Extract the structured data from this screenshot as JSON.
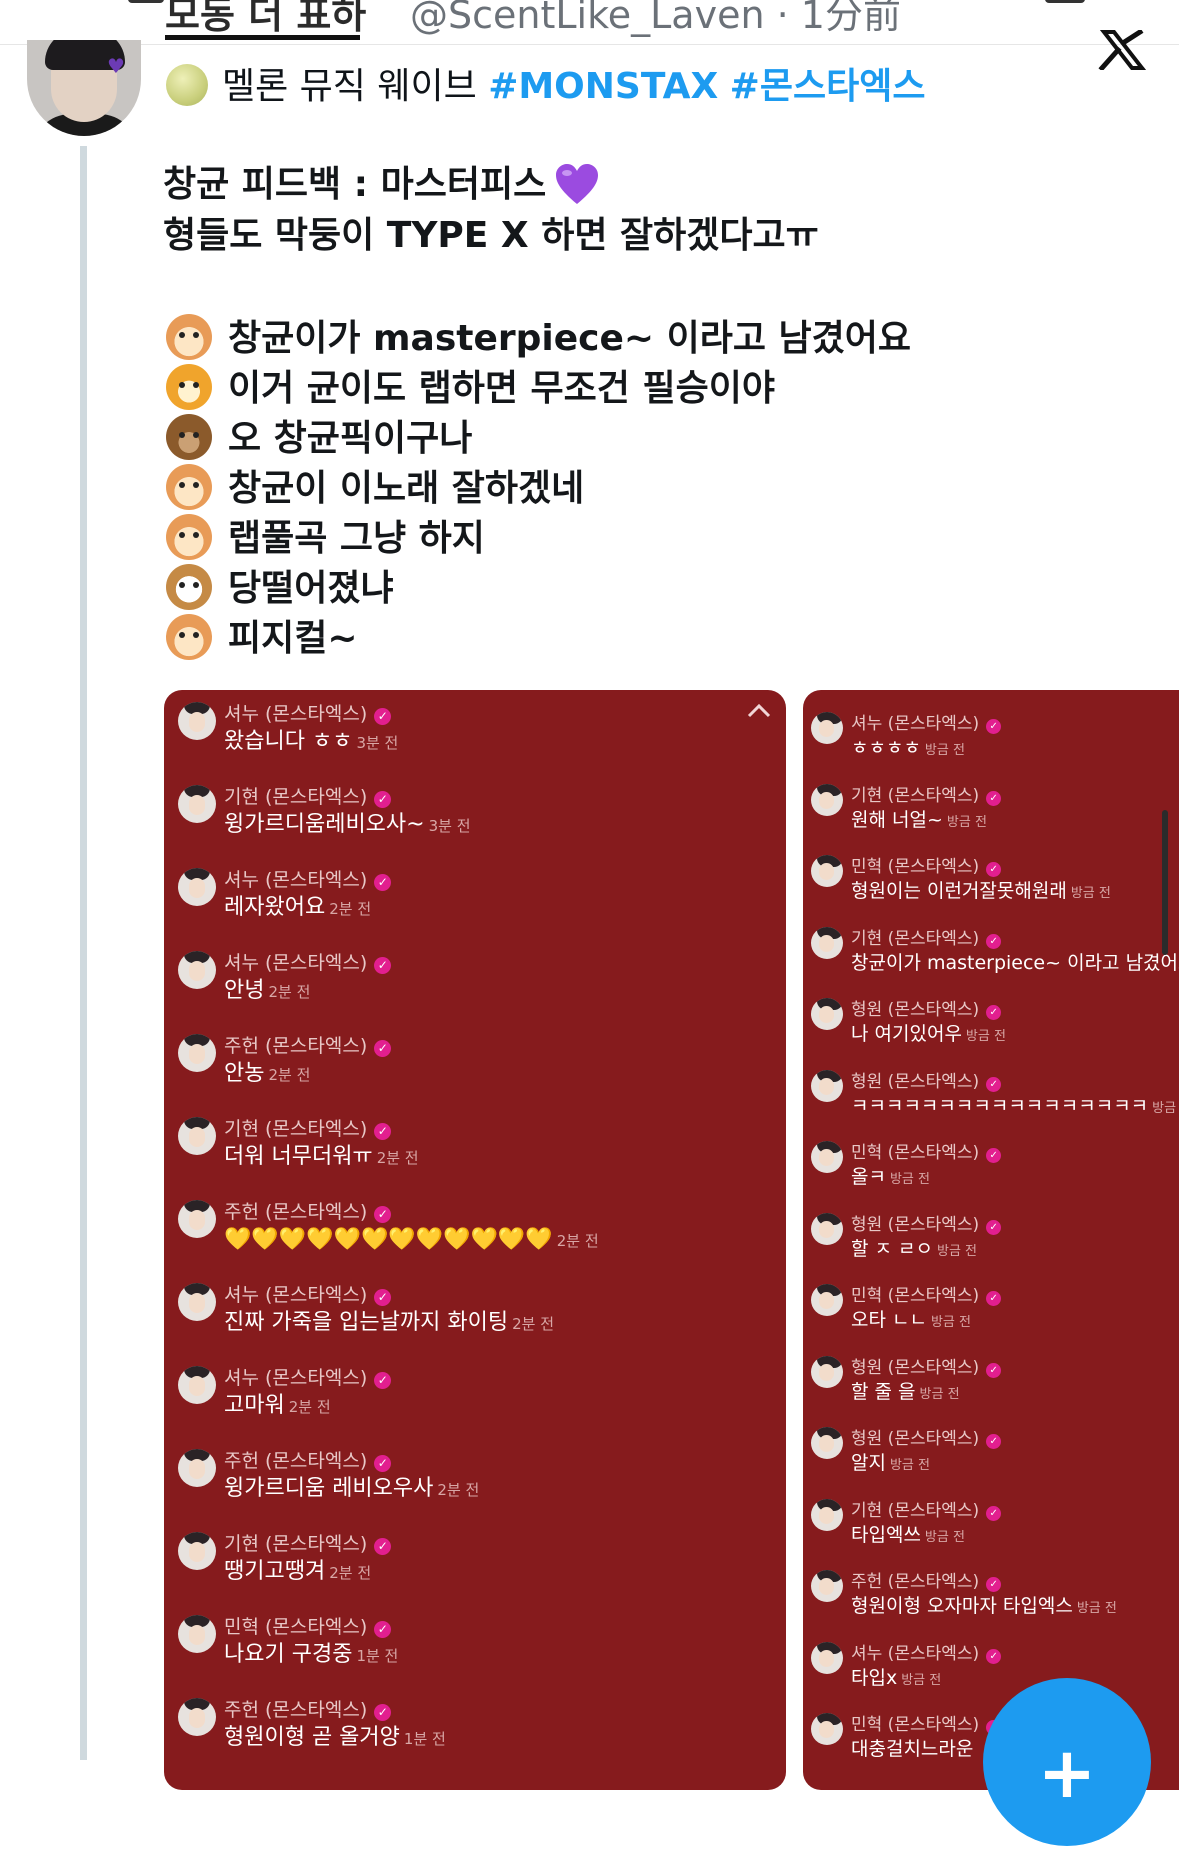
{
  "header": {
    "display_name_cut": "모동 더 표하",
    "handle_cut": "@ScentLike_Laven · 1分前"
  },
  "tweet": {
    "line1_text": "멜론 뮤직 웨이브",
    "hashtag1": "#MONSTAX",
    "hashtag2": "#몬스타엑스",
    "line2": "창균 피드백 : 마스터피스",
    "line3": "형들도 막둥이 TYPE X 하면 잘하겠다고ㅠ",
    "reactions": [
      {
        "icon": "hamster-icon",
        "text": "창균이가 masterpiece~ 이라고 남겼어요"
      },
      {
        "icon": "tiger-icon",
        "text": "이거 균이도 랩하면 무조건 필승이야"
      },
      {
        "icon": "bear-icon",
        "text": "오 창균픽이구나"
      },
      {
        "icon": "hamster-icon",
        "text": "창균이 이노래 잘하겠네"
      },
      {
        "icon": "hamster-icon",
        "text": "랩풀곡 그냥 하지"
      },
      {
        "icon": "dog-icon",
        "text": "당떨어졌냐"
      },
      {
        "icon": "hamster-icon",
        "text": "피지컬~"
      }
    ]
  },
  "chat_left": [
    {
      "name": "셔누 (몬스타엑스)",
      "text": "왔습니다 ㅎㅎ",
      "time": "3분 전"
    },
    {
      "name": "기현 (몬스타엑스)",
      "text": "윙가르디움레비오사~",
      "time": "3분 전"
    },
    {
      "name": "셔누 (몬스타엑스)",
      "text": "레자왔어요",
      "time": "2분 전"
    },
    {
      "name": "셔누 (몬스타엑스)",
      "text": "안녕",
      "time": "2분 전"
    },
    {
      "name": "주헌 (몬스타엑스)",
      "text": "안농",
      "time": "2분 전"
    },
    {
      "name": "기현 (몬스타엑스)",
      "text": "더워 너무더워ㅠ",
      "time": "2분 전"
    },
    {
      "name": "주헌 (몬스타엑스)",
      "text": "💛💛💛💛💛💛💛💛💛💛💛💛",
      "time": "2분 전"
    },
    {
      "name": "셔누 (몬스타엑스)",
      "text": "진짜 가죽을 입는날까지 화이팅",
      "time": "2분 전"
    },
    {
      "name": "셔누 (몬스타엑스)",
      "text": "고마워",
      "time": "2분 전"
    },
    {
      "name": "주헌 (몬스타엑스)",
      "text": "윙가르디움 레비오우사",
      "time": "2분 전"
    },
    {
      "name": "기현 (몬스타엑스)",
      "text": "땡기고땡겨",
      "time": "2분 전"
    },
    {
      "name": "민혁 (몬스타엑스)",
      "text": "나요기 구경중",
      "time": "1분 전"
    },
    {
      "name": "주헌 (몬스타엑스)",
      "text": "형원이형 곧 올거양",
      "time": "1분 전"
    }
  ],
  "chat_right": [
    {
      "name": "셔누 (몬스타엑스)",
      "text": "ㅎㅎㅎㅎ",
      "time": "방금 전"
    },
    {
      "name": "기현 (몬스타엑스)",
      "text": "원해 너얼~",
      "time": "방금 전"
    },
    {
      "name": "민혁 (몬스타엑스)",
      "text": "형원이는 이런거잘못해원래",
      "time": "방금 전"
    },
    {
      "name": "기현 (몬스타엑스)",
      "text": "창균이가 masterpiece~ 이라고 남겼어요",
      "time": ""
    },
    {
      "name": "형원 (몬스타엑스)",
      "text": "나 여기있어우",
      "time": "방금 전"
    },
    {
      "name": "형원 (몬스타엑스)",
      "text": "ㅋㅋㅋㅋㅋㅋㅋㅋㅋㅋㅋㅋㅋㅋㅋㅋㅋ",
      "time": "방금 전"
    },
    {
      "name": "민혁 (몬스타엑스)",
      "text": "올ㅋ",
      "time": "방금 전"
    },
    {
      "name": "형원 (몬스타엑스)",
      "text": "할 ㅈ ㄹㅇ",
      "time": "방금 전"
    },
    {
      "name": "민혁 (몬스타엑스)",
      "text": "오타 ㄴㄴ",
      "time": "방금 전"
    },
    {
      "name": "형원 (몬스타엑스)",
      "text": "할 줄 을",
      "time": "방금 전"
    },
    {
      "name": "형원 (몬스타엑스)",
      "text": "알지",
      "time": "방금 전"
    },
    {
      "name": "기현 (몬스타엑스)",
      "text": "타입엑쓰",
      "time": "방금 전"
    },
    {
      "name": "주헌 (몬스타엑스)",
      "text": "형원이형 오자마자 타입엑스",
      "time": "방금 전"
    },
    {
      "name": "셔누 (몬스타엑스)",
      "text": "타입x",
      "time": "방금 전"
    },
    {
      "name": "민혁 (몬스타엑스)",
      "text": "대충걸치느라운",
      "time": ""
    }
  ],
  "colors": {
    "hashtag": "#1d9bf0",
    "chat_panel": "#861b1d",
    "verified_badge": "#e21f8f",
    "fab": "#1d9bf0"
  },
  "fab": {
    "label": "+"
  }
}
